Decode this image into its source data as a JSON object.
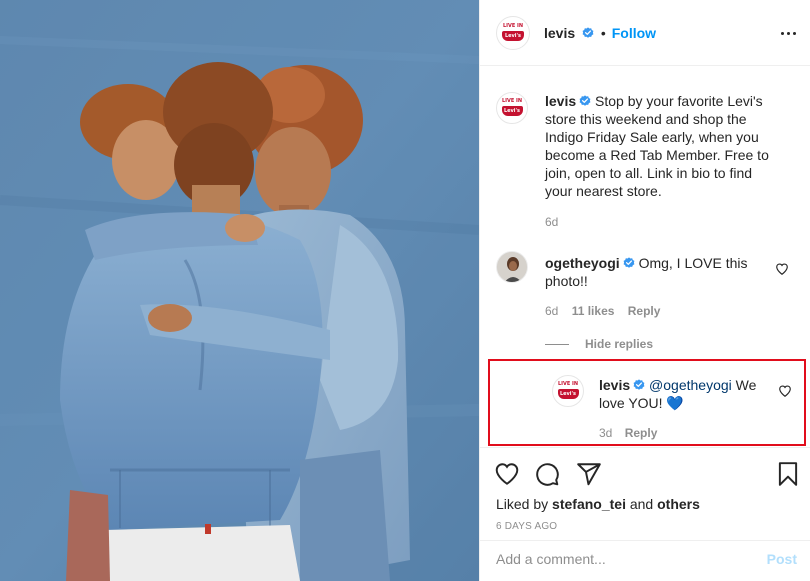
{
  "post": {
    "author": "levis",
    "follow_label": "Follow",
    "separator": "•",
    "avatar_text_top": "LIVE IN",
    "avatar_text_logo": "Levi's",
    "caption_text": "Stop by your favorite Levi's store this weekend and shop the Indigo Friday Sale early, when you become a Red Tab Member. Free to join, open to all. Link in bio to find your nearest store.",
    "caption_time": "6d",
    "colors": {
      "verified": "#3897f0",
      "follow": "#0095f6",
      "highlight": "#e10d1c",
      "link": "#00376b"
    }
  },
  "comment": {
    "author": "ogetheyogi",
    "text": "Omg, I LOVE this photo!!",
    "time": "6d",
    "likes": "11 likes",
    "reply_label": "Reply"
  },
  "hide_replies": "Hide replies",
  "reply": {
    "author": "levis",
    "mention": "@ogetheyogi",
    "text": "We love YOU! 💙",
    "time": "3d",
    "reply_label": "Reply"
  },
  "actions": {
    "icons": [
      "heart-icon",
      "comment-icon",
      "share-icon",
      "bookmark-icon"
    ],
    "liked_prefix": "Liked by",
    "liked_user": "stefano_tei",
    "liked_and": "and",
    "liked_others": "others",
    "time_ago": "6 DAYS AGO"
  },
  "add_comment": {
    "placeholder": "Add a comment...",
    "post_label": "Post"
  }
}
